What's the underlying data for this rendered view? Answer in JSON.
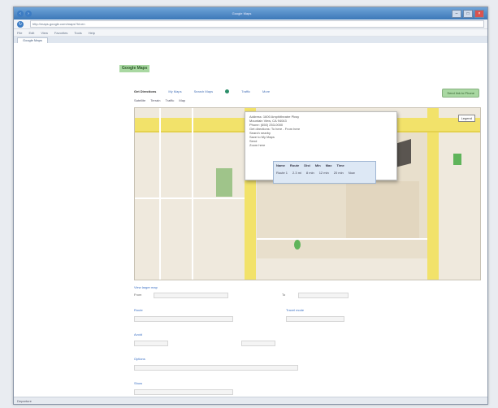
{
  "window": {
    "title": "Google Maps"
  },
  "browser": {
    "url": "http://maps.google.com/maps?hl=en",
    "menu": [
      "File",
      "Edit",
      "View",
      "Favorites",
      "Tools",
      "Help"
    ],
    "tab_title": "Google Maps"
  },
  "page": {
    "logo_text": "Google Maps",
    "top_tabs": [
      "Get Directions",
      "My Maps",
      "Search Maps",
      "Traffic",
      "More"
    ],
    "action_button": "Send link to Phone",
    "options_row": [
      "Satellite",
      "Terrain",
      "Traffic",
      "Map"
    ],
    "legend_button": "Legend",
    "map_link": "View larger map",
    "popup": {
      "lines": [
        "Address: 1600 Amphitheatre Pkwy",
        "Mountain View, CA 94043",
        "Phone: (650) 253-0000",
        "Get directions: To here - From here",
        "Search nearby",
        "Save to My Maps",
        "Send",
        "Zoom here"
      ],
      "table_headers": [
        "Name",
        "Route",
        "Dist",
        "Min",
        "Max",
        "Time"
      ],
      "table_row": [
        "Route 1",
        "2.3 mi",
        "8 min",
        "12 min",
        "20 min",
        "Now"
      ]
    },
    "form": {
      "section1": "Route",
      "section2": "Avoid",
      "section3": "Options",
      "section4": "Show",
      "section5": "Departure",
      "label_from": "From",
      "label_to": "To",
      "mode_title": "Travel mode"
    }
  },
  "colors": {
    "accent": "#3a6fc4",
    "green": "#a9d8a2",
    "road": "#f2e26a"
  },
  "icons": {
    "back": "back-icon",
    "forward": "forward-icon",
    "refresh": "refresh-icon"
  }
}
